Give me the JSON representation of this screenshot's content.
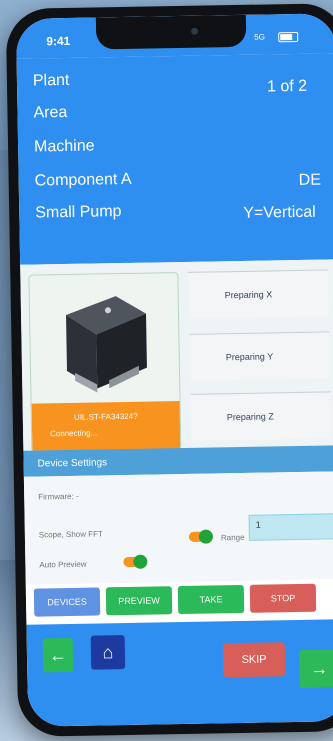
{
  "status_bar": {
    "time": "9:41",
    "network": "5G"
  },
  "header": {
    "rows": [
      {
        "label": "Plant",
        "right": "1 of 2"
      },
      {
        "label": "Area",
        "right": ""
      },
      {
        "label": "Machine",
        "right": ""
      },
      {
        "label": "Component A",
        "right": "DE"
      },
      {
        "label": "Small Pump",
        "right": "Y=Vertical"
      }
    ]
  },
  "sensor": {
    "id": "UIL.ST-FA34324?",
    "status": "Connecting..."
  },
  "preparing": [
    "Preparing X",
    "Preparing Y",
    "Preparing Z"
  ],
  "settings": {
    "title": "Device Settings",
    "firmware": "Firmware: -",
    "scope": "Scope, Show FFT",
    "range_label": "Range",
    "range_value": "1",
    "auto_preview": "Auto Preview"
  },
  "buttons": {
    "devices": "DEVICES",
    "preview": "PREVIEW",
    "take": "TAKE",
    "stop": "STOP",
    "skip": "SKIP"
  },
  "icons": {
    "back": "arrow-left-icon",
    "home": "home-icon",
    "next": "arrow-right-icon"
  }
}
